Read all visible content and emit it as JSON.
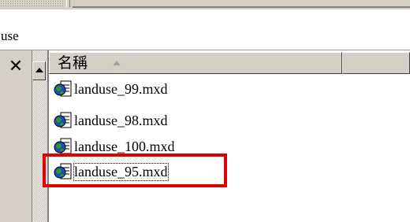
{
  "address_bar": {
    "text": "use"
  },
  "pane": {
    "close_icon": "close-icon",
    "scroll_up_icon": "scroll-up-arrow-icon"
  },
  "column_header": {
    "name_label": "名稱",
    "sort_icon": "sort-ascending-icon"
  },
  "files": [
    {
      "name": "landuse_99.mxd",
      "icon": "mxd-map-document-icon",
      "selected": false
    },
    {
      "name": "landuse_98.mxd",
      "icon": "mxd-map-document-icon",
      "selected": false
    },
    {
      "name": "landuse_100.mxd",
      "icon": "mxd-map-document-icon",
      "selected": false
    },
    {
      "name": "landuse_95.mxd",
      "icon": "mxd-map-document-icon",
      "selected": true
    }
  ],
  "annotation": {
    "color": "#e00000"
  }
}
